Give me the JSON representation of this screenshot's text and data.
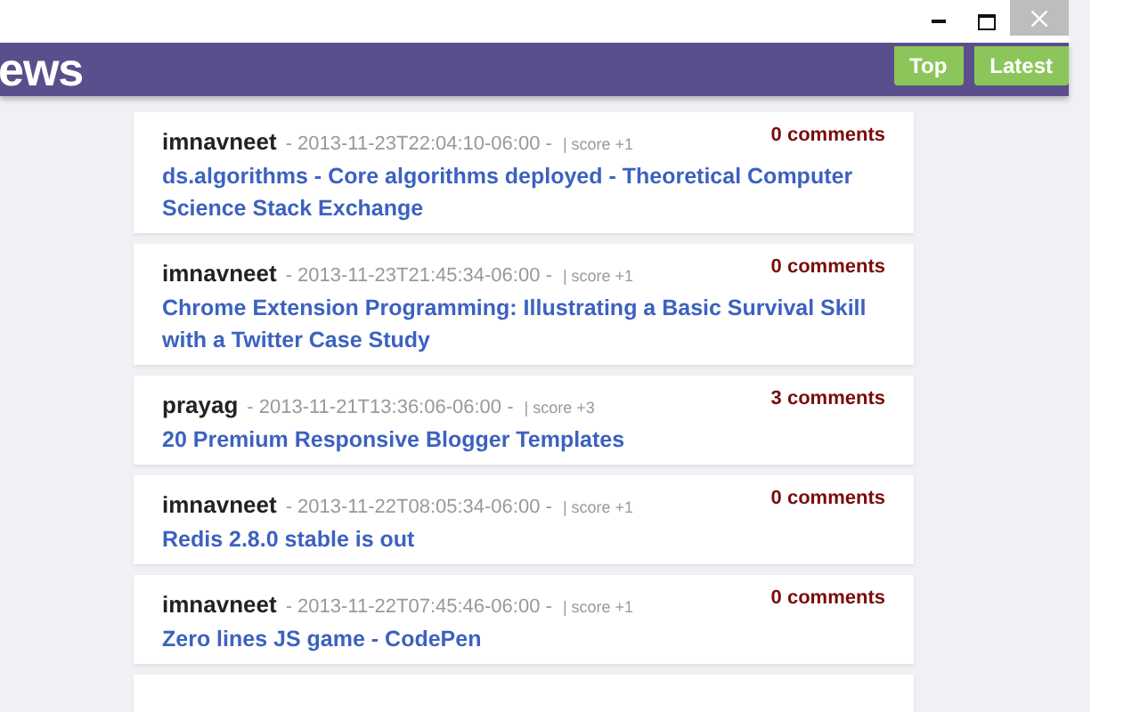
{
  "header": {
    "title": "ews",
    "nav": [
      {
        "label": "Top"
      },
      {
        "label": "Latest"
      }
    ]
  },
  "posts": [
    {
      "author": "imnavneet",
      "time": "- 2013-11-23T22:04:10-06:00 -",
      "score": "| score +1",
      "comments": "0 comments",
      "title": "ds.algorithms - Core algorithms deployed - Theoretical Computer Science Stack Exchange"
    },
    {
      "author": "imnavneet",
      "time": "- 2013-11-23T21:45:34-06:00 -",
      "score": "| score +1",
      "comments": "0 comments",
      "title": "Chrome Extension Programming: Illustrating a Basic Survival Skill with a Twitter Case Study"
    },
    {
      "author": "prayag",
      "time": "- 2013-11-21T13:36:06-06:00 -",
      "score": "| score +3",
      "comments": "3 comments",
      "title": "20 Premium Responsive Blogger Templates"
    },
    {
      "author": "imnavneet",
      "time": "- 2013-11-22T08:05:34-06:00 -",
      "score": "| score +1",
      "comments": "0 comments",
      "title": "Redis 2.8.0 stable is out"
    },
    {
      "author": "imnavneet",
      "time": "- 2013-11-22T07:45:46-06:00 -",
      "score": "| score +1",
      "comments": "0 comments",
      "title": "Zero lines JS game - CodePen"
    }
  ]
}
